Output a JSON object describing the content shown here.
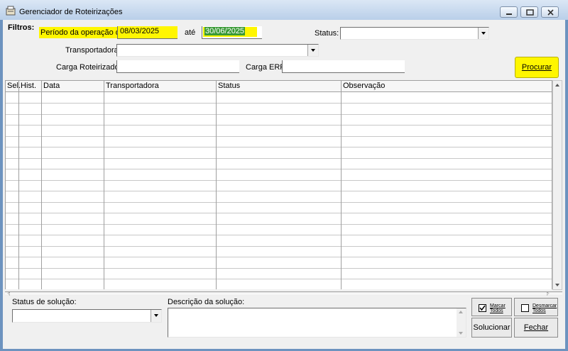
{
  "window": {
    "title": "Gerenciador de Roteirizações"
  },
  "filters": {
    "heading": "Filtros:",
    "period_label": "Período da operação de:",
    "date_from": "08/03/2025",
    "until_label": "até",
    "date_to": "30/06/2025",
    "status_label": "Status:",
    "status_value": "",
    "carrier_label": "Transportadora:",
    "carrier_value": "",
    "route_load_label": "Carga Roteirizador:",
    "route_load_value": "",
    "erp_load_label": "Carga ERP:",
    "erp_load_value": "",
    "search_button": "Procurar"
  },
  "grid": {
    "columns": [
      "Sel.",
      "Hist.",
      "Data",
      "Transportadora",
      "Status",
      "Observação"
    ],
    "rows": []
  },
  "solution": {
    "status_label": "Status de solução:",
    "status_value": "",
    "description_label": "Descrição da solução:",
    "description_value": "",
    "mark_all_label": "Marcar Todos",
    "mark_all_line1": "Marcar",
    "mark_all_line2": "Todos",
    "unmark_all_label": "Desmarcar Todos",
    "unmark_all_line1": "Desmarcar",
    "unmark_all_line2": "Todos",
    "solve_button": "Solucionar",
    "close_button": "Fechar"
  },
  "colors": {
    "highlight": "#fff600",
    "selected_date_bg": "#3a9a36",
    "title_bar": "#c9daf0"
  }
}
